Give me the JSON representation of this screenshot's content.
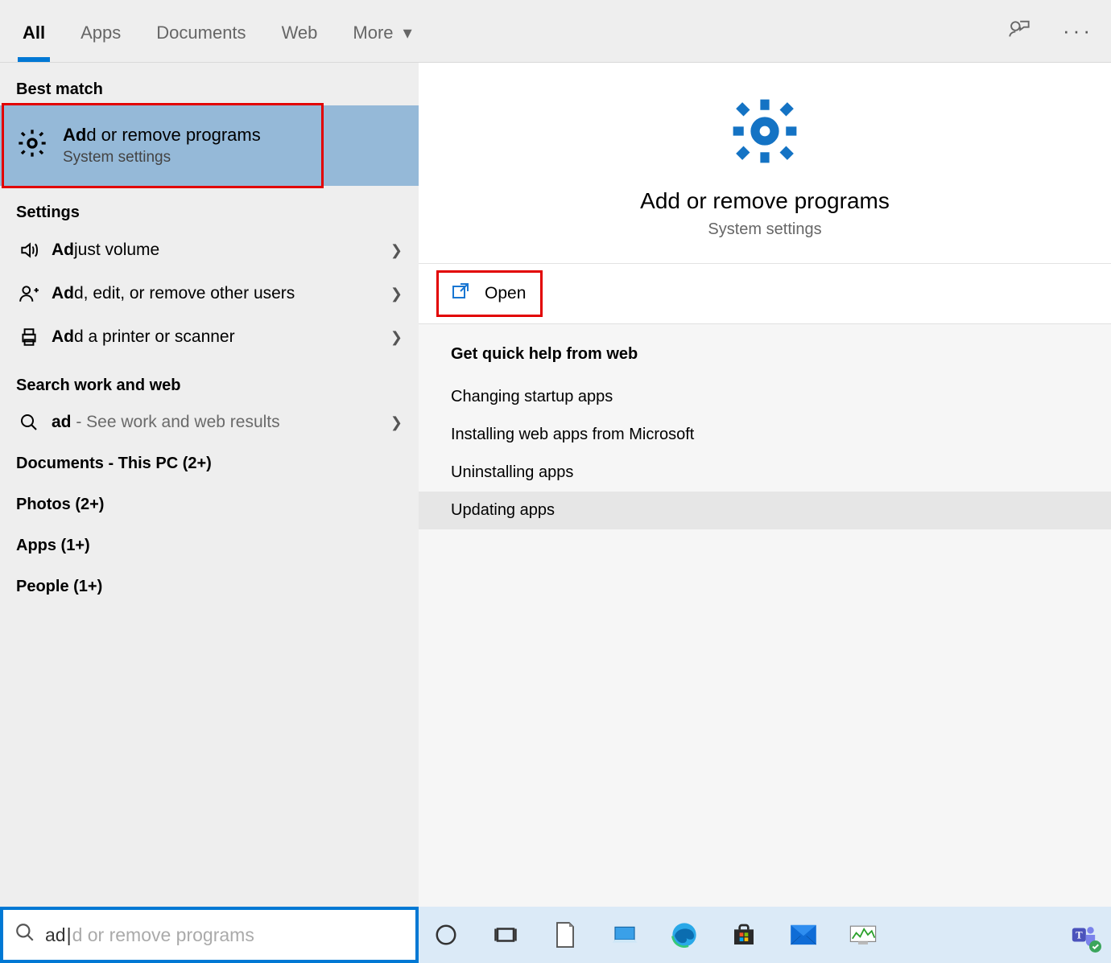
{
  "tabs": {
    "all": "All",
    "apps": "Apps",
    "documents": "Documents",
    "web": "Web",
    "more": "More"
  },
  "sections": {
    "best_match": "Best match",
    "settings": "Settings",
    "search_work_web": "Search work and web",
    "documents_pc": "Documents - This PC (2+)",
    "photos": "Photos (2+)",
    "apps_cat": "Apps (1+)",
    "people": "People (1+)"
  },
  "best_match": {
    "title_bold": "Ad",
    "title_rest": "d or remove programs",
    "subtitle": "System settings"
  },
  "settings_items": [
    {
      "bold": "Ad",
      "rest": "just volume",
      "icon": "volume"
    },
    {
      "bold": "Ad",
      "rest": "d, edit, or remove other users",
      "icon": "user-plus"
    },
    {
      "bold": "Ad",
      "rest": "d a printer or scanner",
      "icon": "printer"
    }
  ],
  "web_search": {
    "bold": "ad",
    "suffix": " - See work and web results"
  },
  "detail": {
    "title": "Add or remove programs",
    "subtitle": "System settings",
    "open_label": "Open"
  },
  "help": {
    "header": "Get quick help from web",
    "links": [
      "Changing startup apps",
      "Installing web apps from Microsoft",
      "Uninstalling apps",
      "Updating apps"
    ]
  },
  "search": {
    "typed": "ad",
    "ghost": "d or remove programs"
  }
}
